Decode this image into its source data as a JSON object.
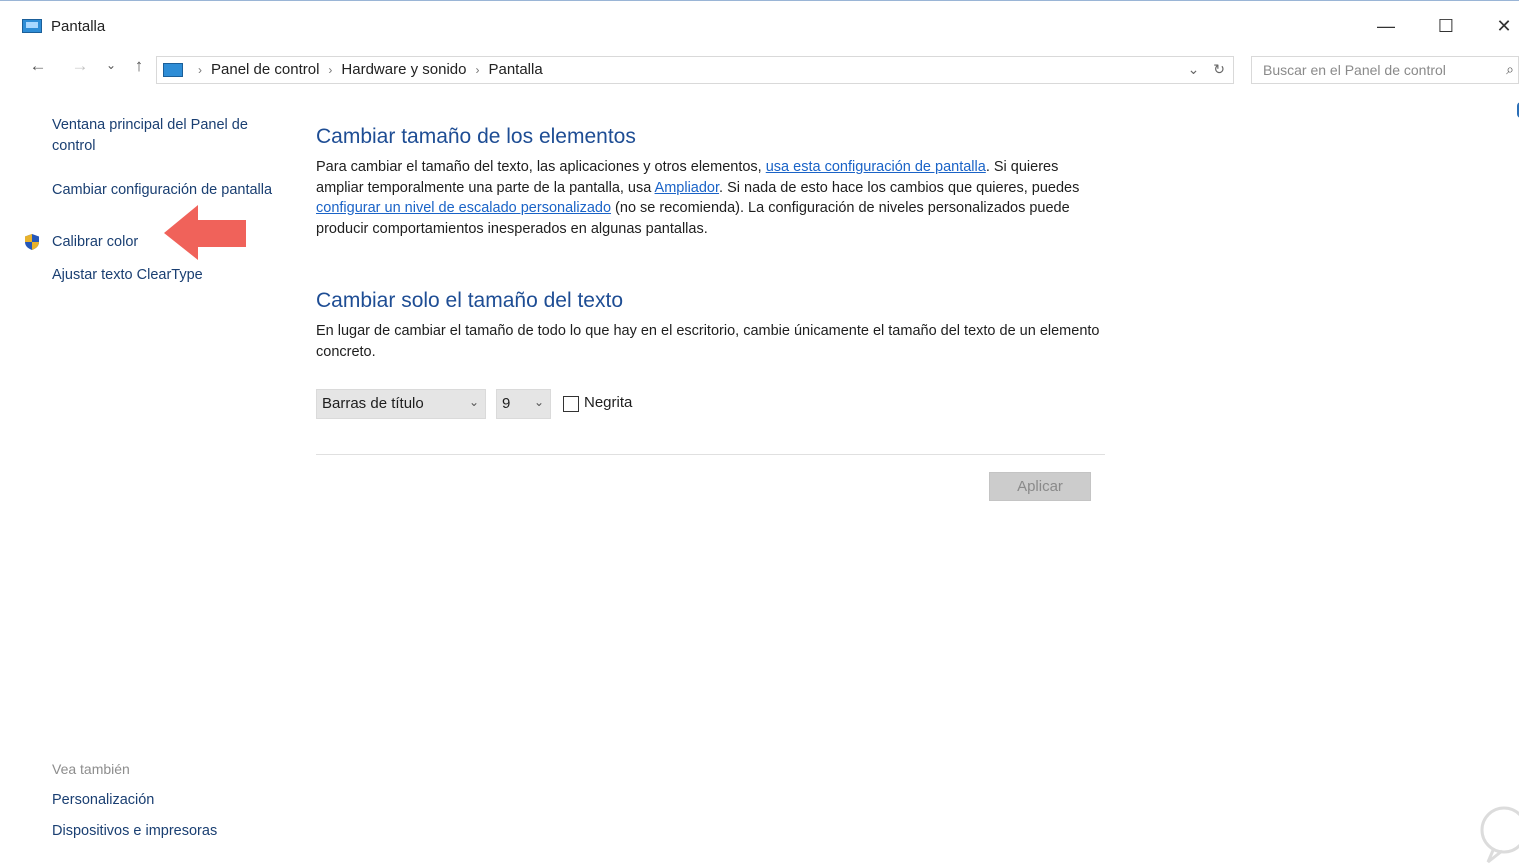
{
  "window": {
    "title": "Pantalla",
    "minimize_glyph": "—",
    "maximize_glyph": "☐",
    "close_glyph": "✕"
  },
  "address_bar": {
    "back_glyph": "←",
    "forward_glyph": "→",
    "recent_glyph": "⌄",
    "up_glyph": "↑",
    "breadcrumbs": [
      "Panel de control",
      "Hardware y sonido",
      "Pantalla"
    ],
    "separator": "›",
    "dropdown_glyph": "⌄",
    "refresh_glyph": "↻"
  },
  "search": {
    "placeholder": "Buscar en el Panel de control",
    "icon": "search-icon",
    "glyph": "⌕"
  },
  "left_pane": {
    "links": [
      "Ventana principal del Panel de control",
      "Cambiar configuración de pantalla",
      "Calibrar color",
      "Ajustar texto ClearType"
    ],
    "see_also_title": "Vea también",
    "see_also_links": [
      "Personalización",
      "Dispositivos e impresoras"
    ]
  },
  "section1": {
    "title": "Cambiar tamaño de los elementos",
    "text1": "Para cambiar el tamaño del texto, las aplicaciones y otros elementos, ",
    "link1": "usa esta configuración de pantalla",
    "text2": ". Si quieres ampliar temporalmente una parte de la pantalla, usa ",
    "link2": "Ampliador",
    "text3": ". Si nada de esto hace los cambios que quieres, puedes ",
    "link3": "configurar un nivel de escalado personalizado",
    "text4": " (no se recomienda). La configuración de niveles personalizados puede producir comportamientos inesperados en algunas pantallas."
  },
  "section2": {
    "title": "Cambiar solo el tamaño del texto",
    "description": "En lugar de cambiar el tamaño de todo lo que hay en el escritorio, cambie únicamente el tamaño del texto de un elemento concreto.",
    "element_select": "Barras de título",
    "size_select": "9",
    "chevron_glyph": "⌄",
    "bold_label": "Negrita",
    "bold_checked": false,
    "apply_label": "Aplicar"
  },
  "colors": {
    "link": "#1a3f72",
    "heading": "#1e4d94",
    "annotation_arrow": "#f0625a"
  }
}
